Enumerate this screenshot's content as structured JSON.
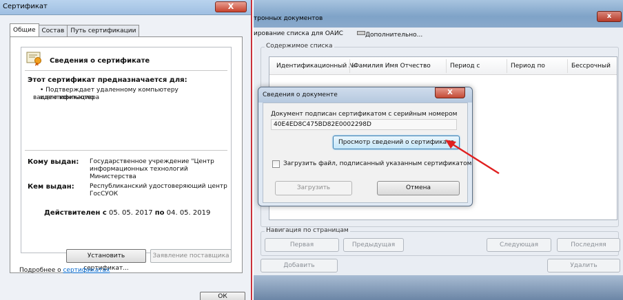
{
  "cert_dialog": {
    "title": "Сертификат",
    "close_glyph": "X",
    "tabs": [
      {
        "label": "Общие",
        "active": true
      },
      {
        "label": "Состав",
        "active": false
      },
      {
        "label": "Путь сертификации",
        "active": false
      }
    ],
    "info_title": "Сведения о сертификате",
    "purpose_heading": "Этот сертификат предназначается для:",
    "purpose_line1": "• Подтверждает удаленному компьютеру идентификацию",
    "purpose_line2": "вашего компьютера",
    "issued_to_label": "Кому выдан:",
    "issued_to_line1": "Государственное учреждение \"Центр",
    "issued_to_line2": "информационных технологий Министерства",
    "issued_by_label": "Кем выдан:",
    "issued_by_line1": "Республиканский удостоверяющий центр",
    "issued_by_line2": "ГосСУОК",
    "valid_label": "Действителен с",
    "valid_from": "05. 05. 2017",
    "valid_to_label": "по",
    "valid_to": "04. 05. 2019",
    "install_button": "Установить сертификат...",
    "issuer_statement_button": "Заявление поставщика",
    "more_prefix": "Подробнее о ",
    "more_link": "сертификатах",
    "ok_button": "ОК"
  },
  "list_window": {
    "title": "тронных документов",
    "close_glyph": "x",
    "toolbar_left": "ирование списка для ОАИС",
    "toolbar_more": "Дополнительно...",
    "contents_group": "Содержимое списка",
    "columns": [
      "Идентификационный №",
      "Фамилия Имя Отчество",
      "Период с",
      "Период по",
      "Бессрочный"
    ],
    "nav_group": "Навигация по страницам",
    "nav_buttons": {
      "first": "Первая",
      "prev": "Предыдущая",
      "next": "Следующая",
      "last": "Последняя"
    },
    "add_button": "Добавить",
    "delete_button": "Удалить"
  },
  "doc_dialog": {
    "title": "Сведения о документе",
    "close_glyph": "X",
    "signed_text": "Документ подписан сертификатом с серийным номером",
    "serial": "40E4ED8C475BD82E0002298D",
    "view_button": "Просмотр сведений о сертификате",
    "checkbox_label": "Загрузить файл, подписанный указанным сертификатом",
    "checkbox_checked": false,
    "upload_button": "Загрузить",
    "cancel_button": "Отмена"
  },
  "colors": {
    "annotation_arrow": "#e02020",
    "window_border_red": "#c9313a",
    "link": "#0066cc"
  }
}
